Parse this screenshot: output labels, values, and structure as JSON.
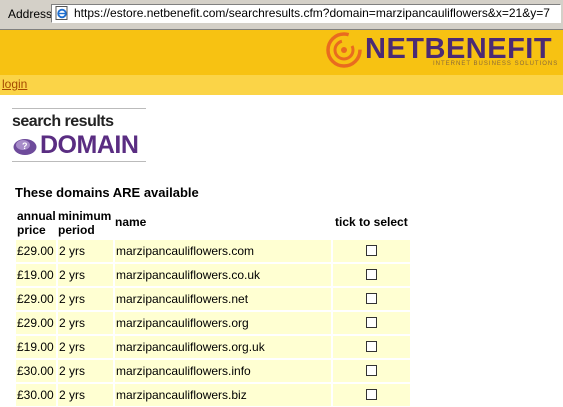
{
  "address_bar": {
    "label": "Address",
    "url": "https://estore.netbenefit.com/searchresults.cfm?domain=marzipancauliflowers&x=21&y=7"
  },
  "brand": {
    "name": "NETBENEFIT",
    "tagline": "INTERNET BUSINESS SOLUTIONS",
    "colors": {
      "header": "#f7c212",
      "logo_text": "#4b2a74",
      "swirl": "#e96b1f"
    }
  },
  "nav": {
    "login": "login"
  },
  "heading": {
    "title": "search results",
    "subtitle": "DOMAIN"
  },
  "availability_heading": "These domains ARE available",
  "table": {
    "headers": {
      "price": [
        "annual",
        "price"
      ],
      "period": [
        "minimum",
        "period"
      ],
      "name": "name",
      "tick": "tick to select"
    },
    "rows": [
      {
        "price": "£29.00",
        "period": "2 yrs",
        "name": "marzipancauliflowers.com",
        "checked": false
      },
      {
        "price": "£19.00",
        "period": "2 yrs",
        "name": "marzipancauliflowers.co.uk",
        "checked": false
      },
      {
        "price": "£29.00",
        "period": "2 yrs",
        "name": "marzipancauliflowers.net",
        "checked": false
      },
      {
        "price": "£29.00",
        "period": "2 yrs",
        "name": "marzipancauliflowers.org",
        "checked": false
      },
      {
        "price": "£19.00",
        "period": "2 yrs",
        "name": "marzipancauliflowers.org.uk",
        "checked": false
      },
      {
        "price": "£30.00",
        "period": "2 yrs",
        "name": "marzipancauliflowers.info",
        "checked": false
      },
      {
        "price": "£30.00",
        "period": "2 yrs",
        "name": "marzipancauliflowers.biz",
        "checked": false
      }
    ]
  }
}
